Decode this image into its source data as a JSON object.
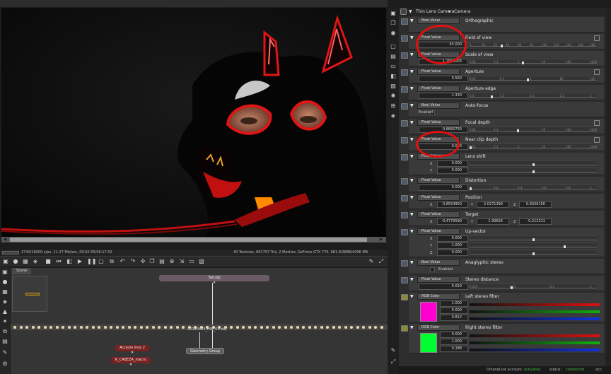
{
  "viewport": {
    "scene_description": "rendered latex dog mask"
  },
  "statusbar": {
    "left": "2743/16000 s/px, 11.27 Mb/sec, 00:02:55/00:17:02",
    "right": "40 Textures, 681797 Tris, 2 Meshes, GeForce GTX 770, 981.8/3888/4096 MB"
  },
  "graph": {
    "tab": "Scene",
    "nodes": {
      "tail": "Tail.obj",
      "mesh": "20140423_HW_01.obj",
      "group": "Geometry Group",
      "accesorios": "Accesio Inox 2",
      "cabeza": "K_CABEZA_macro"
    }
  },
  "panel": {
    "header_title": "Thin Lens Camera",
    "header_type": "Camera"
  },
  "rows": {
    "orthographic": {
      "type": "Bool Value",
      "label": "Orthographic"
    },
    "fov": {
      "type": "Float Value",
      "label": "Field of view",
      "value": "45.000",
      "ticks": [
        "1",
        "10",
        "20",
        "40",
        "60",
        "80",
        "100",
        "120",
        "140",
        "160",
        "180"
      ]
    },
    "scale": {
      "type": "Float Value",
      "label": "Scale of view",
      "value": "1.2056003",
      "ticks": [
        "0.01",
        "0.1",
        "1",
        "10",
        "100",
        "1000"
      ]
    },
    "aperture": {
      "type": "Float Value",
      "label": "Aperture",
      "value": "0.560",
      "ticks": [
        "0.01",
        "0.1",
        "1",
        "10",
        "100"
      ]
    },
    "aperture_edge": {
      "type": "Float Value",
      "label": "Aperture edge",
      "value": "1.330",
      "ticks": [
        "1.0",
        "1.5",
        "2.0",
        "2.5",
        "3"
      ]
    },
    "autofocus": {
      "type": "Bool Value",
      "label": "Auto-focus",
      "enabled": "Enabled"
    },
    "focal": {
      "type": "Float Value",
      "label": "Focal depth",
      "value": "0.8860730",
      "ticks": [
        "0.01",
        "0.1",
        "1",
        "10",
        "100",
        "1000"
      ]
    },
    "nearclip": {
      "type": "Float Value",
      "label": "Near clip depth",
      "value": "0.000",
      "ticks": [
        "0.01",
        "0.1",
        "1",
        "10",
        "100",
        "1000"
      ]
    },
    "lensshift": {
      "type": "Float Value",
      "label": "Lens shift",
      "x": "0.000",
      "y": "0.000"
    },
    "distortion": {
      "type": "Float Value",
      "label": "Distortion",
      "value": "0.000",
      "ticks": [
        "0",
        "0.2",
        "0.4",
        "0.6",
        "0.8",
        "1"
      ]
    },
    "position": {
      "type": "Float Value",
      "label": "Position",
      "x": "0.6554950",
      "y": "2.0271399",
      "z": "0.6926150"
    },
    "target": {
      "type": "Float Value",
      "label": "Target",
      "x": "-0.4779590",
      "y": "1.90626",
      "z": "-0.212211"
    },
    "upvector": {
      "type": "Float Value",
      "label": "Up-vector",
      "x": "0.000",
      "y": "1.000",
      "z": "0.000"
    },
    "anaglyphic": {
      "type": "Bool Value",
      "label": "Anaglyphic stereo",
      "enabled": "Enabled"
    },
    "stereo_dist": {
      "type": "Float Value",
      "label": "Stereo distance",
      "value": "0.020",
      "ticks": [
        "0.001",
        "0.01",
        "0.1",
        "1"
      ]
    },
    "left_filter": {
      "type": "RGB Color",
      "label": "Left stereo filter",
      "r": "1.000",
      "g": "0.000",
      "b": "0.812",
      "swatch": "#ff00d0"
    },
    "right_filter": {
      "type": "RGB Color",
      "label": "Right stereo filter",
      "r": "0.000",
      "g": "1.000",
      "b": "0.188",
      "swatch": "#00ff30"
    }
  },
  "bottom": {
    "account_label": "OctaneLive account:",
    "account_value": "activated",
    "status_label": "status:",
    "status_value": "connected",
    "act": "act:"
  },
  "colors": {
    "accent_green": "#3fbf3f",
    "annotation_red": "#e01010"
  }
}
